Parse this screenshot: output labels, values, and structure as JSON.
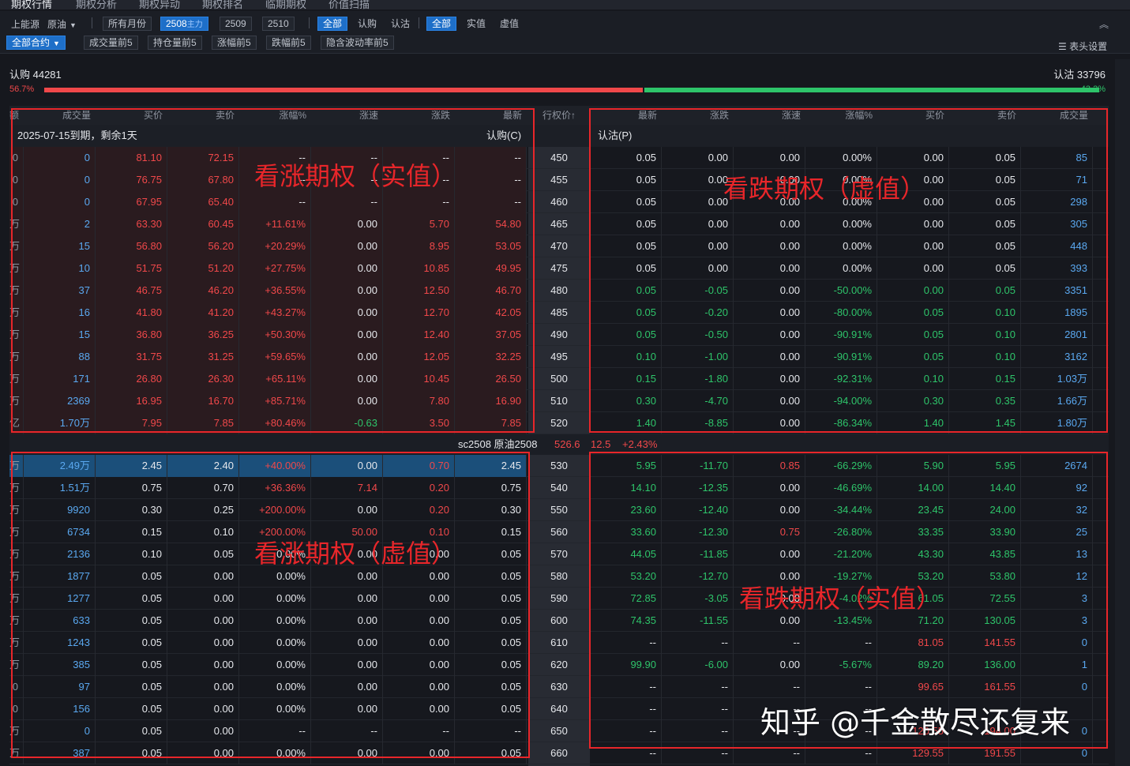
{
  "tabs": [
    "期权行情",
    "期权分析",
    "期权异动",
    "期权排名",
    "临期期权",
    "价值扫描"
  ],
  "toolbar1": {
    "exchange": "上能源",
    "product": "原油",
    "all_months": "所有月份",
    "months": [
      {
        "label": "2508",
        "sub": "主力"
      },
      {
        "label": "2509",
        "sub": ""
      },
      {
        "label": "2510",
        "sub": ""
      }
    ],
    "type_filter": [
      "全部",
      "认购",
      "认沽"
    ],
    "value_filter": [
      "全部",
      "实值",
      "虚值"
    ]
  },
  "toolbar2": {
    "all_contracts": "全部合约",
    "quick_filters": [
      "成交量前5",
      "持仓量前5",
      "涨幅前5",
      "跌幅前5",
      "隐含波动率前5"
    ],
    "column_settings": "表头设置"
  },
  "ratio": {
    "call_label": "认购 44281",
    "put_label": "认沽 33796",
    "call_pct": "56.7%",
    "put_pct": "43.3%",
    "call_fraction": 0.567,
    "put_fraction": 0.433,
    "call_color": "#f0484a",
    "put_color": "#2ec46a"
  },
  "headers": {
    "call": [
      "额",
      "成交量",
      "买价",
      "卖价",
      "涨幅%",
      "涨速",
      "涨跌",
      "最新"
    ],
    "strike": "行权价↑",
    "put": [
      "最新",
      "涨跌",
      "涨速",
      "涨幅%",
      "买价",
      "卖价",
      "成交量"
    ]
  },
  "expiry": {
    "left": "2025-07-15到期，剩余1天",
    "call_tag": "认购(C)",
    "put_tag": "认沽(P)"
  },
  "underlying": {
    "name": "sc2508 原油2508",
    "price": "526.6",
    "change": "12.5",
    "pct": "+2.43%"
  },
  "rows_top": [
    {
      "stub": "0",
      "c": [
        "0",
        "81.10",
        "72.15",
        "--",
        "--",
        "--",
        "--"
      ],
      "k": "450",
      "p": [
        "0.05",
        "0.00",
        "0.00",
        "0.00%",
        "0.00",
        "0.05",
        "85"
      ]
    },
    {
      "stub": "0",
      "c": [
        "0",
        "76.75",
        "67.80",
        "--",
        "--",
        "--",
        "--"
      ],
      "k": "455",
      "p": [
        "0.05",
        "0.00",
        "0.00",
        "0.00%",
        "0.00",
        "0.05",
        "71"
      ]
    },
    {
      "stub": "0",
      "c": [
        "0",
        "67.95",
        "65.40",
        "--",
        "--",
        "--",
        "--"
      ],
      "k": "460",
      "p": [
        "0.05",
        "0.00",
        "0.00",
        "0.00%",
        "0.00",
        "0.05",
        "298"
      ]
    },
    {
      "stub": "万",
      "c": [
        "2",
        "63.30",
        "60.45",
        "+11.61%",
        "0.00",
        "5.70",
        "54.80"
      ],
      "k": "465",
      "p": [
        "0.05",
        "0.00",
        "0.00",
        "0.00%",
        "0.00",
        "0.05",
        "305"
      ]
    },
    {
      "stub": "万",
      "c": [
        "15",
        "56.80",
        "56.20",
        "+20.29%",
        "0.00",
        "8.95",
        "53.05"
      ],
      "k": "470",
      "p": [
        "0.05",
        "0.00",
        "0.00",
        "0.00%",
        "0.00",
        "0.05",
        "448"
      ]
    },
    {
      "stub": "万",
      "c": [
        "10",
        "51.75",
        "51.20",
        "+27.75%",
        "0.00",
        "10.85",
        "49.95"
      ],
      "k": "475",
      "p": [
        "0.05",
        "0.00",
        "0.00",
        "0.00%",
        "0.00",
        "0.05",
        "393"
      ]
    },
    {
      "stub": "万",
      "c": [
        "37",
        "46.75",
        "46.20",
        "+36.55%",
        "0.00",
        "12.50",
        "46.70"
      ],
      "k": "480",
      "p": [
        "0.05",
        "-0.05",
        "0.00",
        "-50.00%",
        "0.00",
        "0.05",
        "3351"
      ]
    },
    {
      "stub": "万",
      "c": [
        "16",
        "41.80",
        "41.20",
        "+43.27%",
        "0.00",
        "12.70",
        "42.05"
      ],
      "k": "485",
      "p": [
        "0.05",
        "-0.20",
        "0.00",
        "-80.00%",
        "0.05",
        "0.10",
        "1895"
      ]
    },
    {
      "stub": "万",
      "c": [
        "15",
        "36.80",
        "36.25",
        "+50.30%",
        "0.00",
        "12.40",
        "37.05"
      ],
      "k": "490",
      "p": [
        "0.05",
        "-0.50",
        "0.00",
        "-90.91%",
        "0.05",
        "0.10",
        "2801"
      ]
    },
    {
      "stub": "万",
      "c": [
        "88",
        "31.75",
        "31.25",
        "+59.65%",
        "0.00",
        "12.05",
        "32.25"
      ],
      "k": "495",
      "p": [
        "0.10",
        "-1.00",
        "0.00",
        "-90.91%",
        "0.05",
        "0.10",
        "3162"
      ]
    },
    {
      "stub": "万",
      "c": [
        "171",
        "26.80",
        "26.30",
        "+65.11%",
        "0.00",
        "10.45",
        "26.50"
      ],
      "k": "500",
      "p": [
        "0.15",
        "-1.80",
        "0.00",
        "-92.31%",
        "0.10",
        "0.15",
        "1.03万"
      ]
    },
    {
      "stub": "万",
      "c": [
        "2369",
        "16.95",
        "16.70",
        "+85.71%",
        "0.00",
        "7.80",
        "16.90"
      ],
      "k": "510",
      "p": [
        "0.30",
        "-4.70",
        "0.00",
        "-94.00%",
        "0.30",
        "0.35",
        "1.66万"
      ]
    },
    {
      "stub": "亿",
      "c": [
        "1.70万",
        "7.95",
        "7.85",
        "+80.46%",
        "-0.63",
        "3.50",
        "7.85"
      ],
      "k": "520",
      "p": [
        "1.40",
        "-8.85",
        "0.00",
        "-86.34%",
        "1.40",
        "1.45",
        "1.80万"
      ]
    }
  ],
  "rows_bottom": [
    {
      "stub": "万",
      "c": [
        "2.49万",
        "2.45",
        "2.40",
        "+40.00%",
        "0.00",
        "0.70",
        "2.45"
      ],
      "k": "530",
      "p": [
        "5.95",
        "-11.70",
        "0.85",
        "-66.29%",
        "5.90",
        "5.95",
        "2674"
      ]
    },
    {
      "stub": "万",
      "c": [
        "1.51万",
        "0.75",
        "0.70",
        "+36.36%",
        "7.14",
        "0.20",
        "0.75"
      ],
      "k": "540",
      "p": [
        "14.10",
        "-12.35",
        "0.00",
        "-46.69%",
        "14.00",
        "14.40",
        "92"
      ]
    },
    {
      "stub": "万",
      "c": [
        "9920",
        "0.30",
        "0.25",
        "+200.00%",
        "0.00",
        "0.20",
        "0.30"
      ],
      "k": "550",
      "p": [
        "23.60",
        "-12.40",
        "0.00",
        "-34.44%",
        "23.45",
        "24.00",
        "32"
      ]
    },
    {
      "stub": "万",
      "c": [
        "6734",
        "0.15",
        "0.10",
        "+200.00%",
        "50.00",
        "0.10",
        "0.15"
      ],
      "k": "560",
      "p": [
        "33.60",
        "-12.30",
        "0.75",
        "-26.80%",
        "33.35",
        "33.90",
        "25"
      ]
    },
    {
      "stub": "万",
      "c": [
        "2136",
        "0.10",
        "0.05",
        "0.00%",
        "0.00",
        "0.00",
        "0.05"
      ],
      "k": "570",
      "p": [
        "44.05",
        "-11.85",
        "0.00",
        "-21.20%",
        "43.30",
        "43.85",
        "13"
      ]
    },
    {
      "stub": "万",
      "c": [
        "1877",
        "0.05",
        "0.00",
        "0.00%",
        "0.00",
        "0.00",
        "0.05"
      ],
      "k": "580",
      "p": [
        "53.20",
        "-12.70",
        "0.00",
        "-19.27%",
        "53.20",
        "53.80",
        "12"
      ]
    },
    {
      "stub": "万",
      "c": [
        "1277",
        "0.05",
        "0.00",
        "0.00%",
        "0.00",
        "0.00",
        "0.05"
      ],
      "k": "590",
      "p": [
        "72.85",
        "-3.05",
        "0.00",
        "-4.02%",
        "61.05",
        "72.55",
        "3"
      ]
    },
    {
      "stub": "万",
      "c": [
        "633",
        "0.05",
        "0.00",
        "0.00%",
        "0.00",
        "0.00",
        "0.05"
      ],
      "k": "600",
      "p": [
        "74.35",
        "-11.55",
        "0.00",
        "-13.45%",
        "71.20",
        "130.05",
        "3"
      ]
    },
    {
      "stub": "万",
      "c": [
        "1243",
        "0.05",
        "0.00",
        "0.00%",
        "0.00",
        "0.00",
        "0.05"
      ],
      "k": "610",
      "p": [
        "--",
        "--",
        "--",
        "--",
        "81.05",
        "141.55",
        "0"
      ]
    },
    {
      "stub": "万",
      "c": [
        "385",
        "0.05",
        "0.00",
        "0.00%",
        "0.00",
        "0.00",
        "0.05"
      ],
      "k": "620",
      "p": [
        "99.90",
        "-6.00",
        "0.00",
        "-5.67%",
        "89.20",
        "136.00",
        "1"
      ]
    },
    {
      "stub": "0",
      "c": [
        "97",
        "0.05",
        "0.00",
        "0.00%",
        "0.00",
        "0.00",
        "0.05"
      ],
      "k": "630",
      "p": [
        "--",
        "--",
        "--",
        "--",
        "99.65",
        "161.55",
        "0"
      ]
    },
    {
      "stub": "0",
      "c": [
        "156",
        "0.05",
        "0.00",
        "0.00%",
        "0.00",
        "0.00",
        "0.05"
      ],
      "k": "640",
      "p": [
        "--",
        "--",
        "--",
        "--",
        "",
        "",
        ""
      ]
    },
    {
      "stub": "万",
      "c": [
        "0",
        "0.05",
        "0.00",
        "--",
        "--",
        "--",
        "--"
      ],
      "k": "650",
      "p": [
        "--",
        "--",
        "--",
        "--",
        "120.55",
        "194.00",
        "0"
      ]
    },
    {
      "stub": "万",
      "c": [
        "387",
        "0.05",
        "0.00",
        "0.00%",
        "0.00",
        "0.00",
        "0.05"
      ],
      "k": "660",
      "p": [
        "--",
        "--",
        "--",
        "--",
        "129.55",
        "191.55",
        "0"
      ]
    }
  ],
  "annotations": {
    "call_itm": "看涨期权（实值）",
    "put_otm": "看跌期权（虚值）",
    "call_otm": "看涨期权（虚值）",
    "put_itm": "看跌期权（实值）",
    "color": "#e8262a"
  },
  "watermark": "知乎 @千金散尽还复来",
  "icons": [
    "dropdown-caret-icon",
    "collapse-up-icon",
    "column-settings-icon"
  ]
}
